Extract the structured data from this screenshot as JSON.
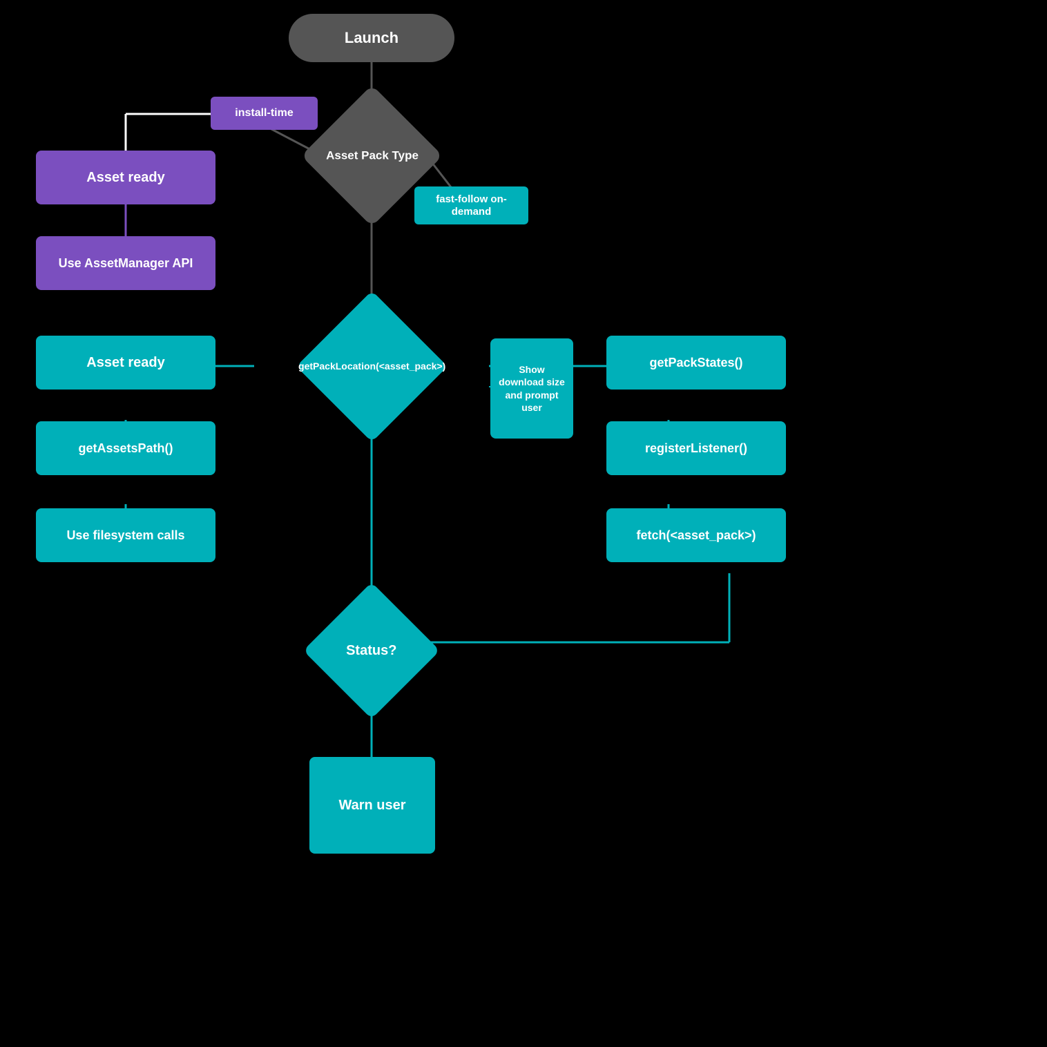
{
  "nodes": {
    "launch": {
      "label": "Launch"
    },
    "asset_pack_type": {
      "label": "Asset Pack\nType"
    },
    "install_time": {
      "label": "install-time"
    },
    "fast_follow_on_demand": {
      "label": "fast-follow\non-demand"
    },
    "asset_ready_1": {
      "label": "Asset ready"
    },
    "use_asset_manager": {
      "label": "Use AssetManager API"
    },
    "get_pack_location": {
      "label": "getPackLocation(<asset_pack>)"
    },
    "asset_ready_2": {
      "label": "Asset ready"
    },
    "get_assets_path": {
      "label": "getAssetsPath()"
    },
    "use_filesystem": {
      "label": "Use filesystem calls"
    },
    "get_pack_states": {
      "label": "getPackStates()"
    },
    "register_listener": {
      "label": "registerListener()"
    },
    "fetch_asset_pack": {
      "label": "fetch(<asset_pack>)"
    },
    "show_download": {
      "label": "Show\ndownload\nsize and\nprompt\nuser"
    },
    "status": {
      "label": "Status?"
    },
    "warn_user": {
      "label": "Warn\nuser"
    }
  }
}
